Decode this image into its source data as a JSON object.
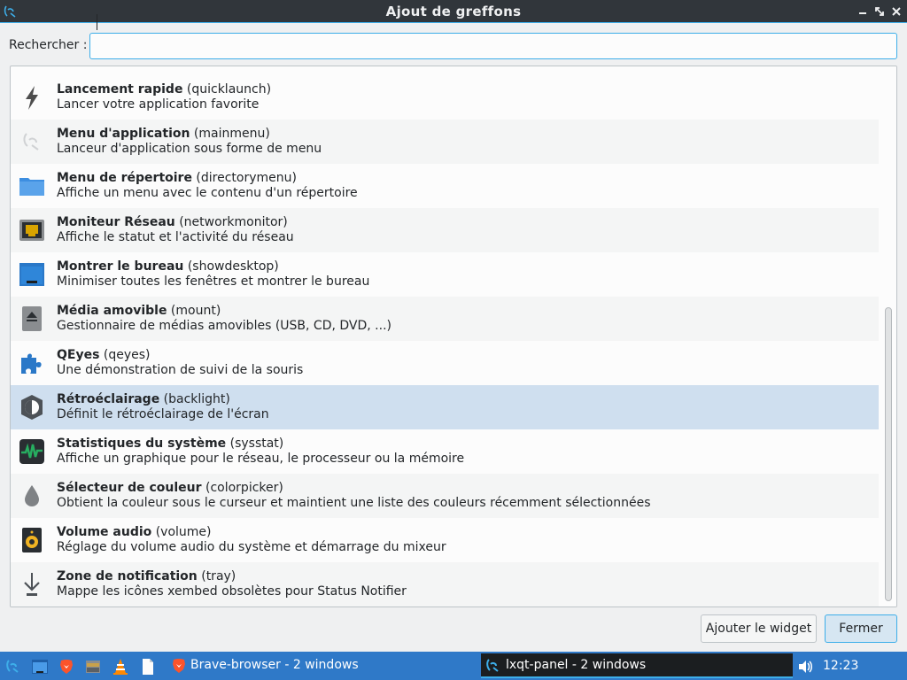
{
  "window": {
    "title": "Ajout de greffons"
  },
  "search": {
    "label": "Rechercher :",
    "value": "",
    "placeholder": ""
  },
  "plugins": [
    {
      "name": "Lancement rapide",
      "id": "(quicklaunch)",
      "desc": "Lancer votre application favorite",
      "icon": "lightning-icon"
    },
    {
      "name": "Menu d'application",
      "id": "(mainmenu)",
      "desc": "Lanceur d'application sous forme de menu",
      "icon": "lxqt-logo-icon"
    },
    {
      "name": "Menu de répertoire",
      "id": "(directorymenu)",
      "desc": "Affiche un menu avec le contenu d'un répertoire",
      "icon": "folder-icon"
    },
    {
      "name": "Moniteur Réseau",
      "id": "(networkmonitor)",
      "desc": "Affiche le statut et l'activité du réseau",
      "icon": "network-port-icon"
    },
    {
      "name": "Montrer le bureau",
      "id": "(showdesktop)",
      "desc": "Minimiser toutes les fenêtres et montrer le bureau",
      "icon": "show-desktop-icon"
    },
    {
      "name": "Média amovible",
      "id": "(mount)",
      "desc": "Gestionnaire de médias amovibles (USB, CD, DVD, ...)",
      "icon": "eject-icon"
    },
    {
      "name": "QEyes",
      "id": "(qeyes)",
      "desc": "Une démonstration de suivi de la souris",
      "icon": "puzzle-icon"
    },
    {
      "name": "Rétroéclairage",
      "id": "(backlight)",
      "desc": "Définit le rétroéclairage de l'écran",
      "icon": "brightness-icon"
    },
    {
      "name": "Statistiques du système",
      "id": "(sysstat)",
      "desc": "Affiche un graphique pour le réseau, le processeur ou la mémoire",
      "icon": "system-monitor-icon"
    },
    {
      "name": "Sélecteur de couleur",
      "id": "(colorpicker)",
      "desc": "Obtient la couleur sous le curseur et maintient une liste des couleurs récemment sélectionnées",
      "icon": "color-drop-icon"
    },
    {
      "name": "Volume audio",
      "id": "(volume)",
      "desc": "Réglage du volume audio du système et démarrage du mixeur",
      "icon": "speaker-icon"
    },
    {
      "name": "Zone de notification",
      "id": "(tray)",
      "desc": "Mappe les icônes xembed obsolètes pour Status Notifier",
      "icon": "tray-arrow-icon"
    }
  ],
  "buttons": {
    "add": "Ajouter le widget",
    "close": "Fermer"
  },
  "taskbar": {
    "task_brave": "Brave-browser - 2 windows",
    "task_panel": "lxqt-panel - 2 windows",
    "clock": "12:23"
  },
  "colors": {
    "accent": "#3daee9",
    "selection": "#cfdfef",
    "taskbar": "#2f79c8",
    "titlebar": "#31363b"
  }
}
